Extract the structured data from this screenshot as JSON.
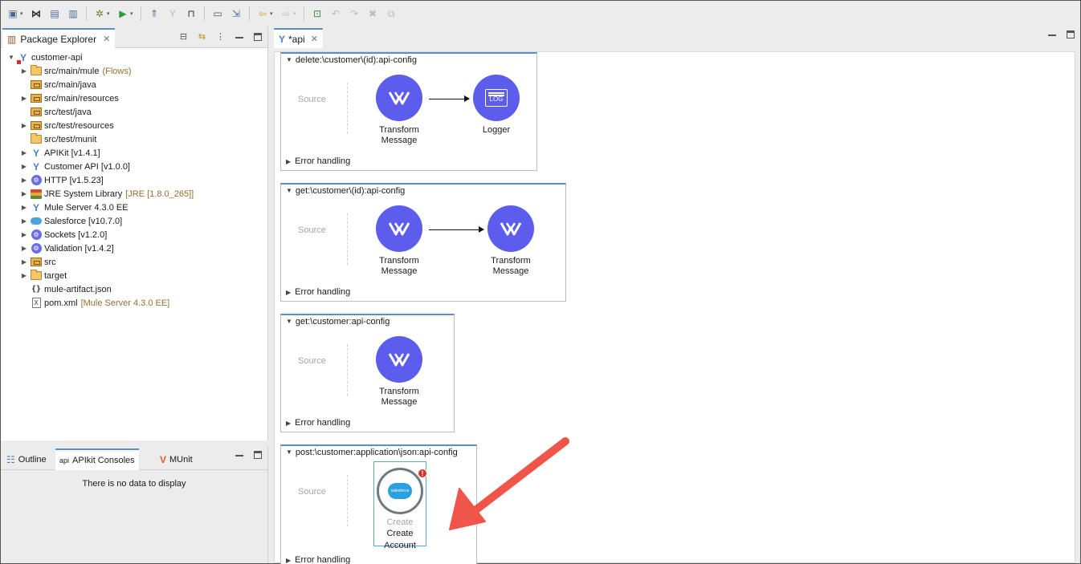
{
  "toolbar": {
    "buttons": [
      "new-wizard-icon",
      "mule-studio-icon",
      "save-icon",
      "save-all-icon",
      "debug-icon",
      "run-icon",
      "deploy-icon",
      "plug-icon",
      "lock-icon",
      "mediator-icon",
      "import-icon",
      "back-icon",
      "forward-icon",
      "new-task-icon",
      "undo-icon",
      "redo-icon",
      "delete-icon",
      "copy-icon"
    ]
  },
  "package_explorer": {
    "tab_label": "Package Explorer",
    "tree": [
      {
        "label": "customer-api",
        "deco": "",
        "icon": "mule-project-icon",
        "expanded": true,
        "level": 0
      },
      {
        "label": "src/main/mule",
        "deco": "(Flows)",
        "icon": "folder-icon",
        "expandable": true,
        "level": 1
      },
      {
        "label": "src/main/java",
        "deco": "",
        "icon": "package-icon",
        "expandable": false,
        "level": 1
      },
      {
        "label": "src/main/resources",
        "deco": "",
        "icon": "package-icon",
        "expandable": true,
        "level": 1
      },
      {
        "label": "src/test/java",
        "deco": "",
        "icon": "package-icon",
        "expandable": false,
        "level": 1
      },
      {
        "label": "src/test/resources",
        "deco": "",
        "icon": "package-icon",
        "expandable": true,
        "level": 1
      },
      {
        "label": "src/test/munit",
        "deco": "",
        "icon": "folder-icon",
        "expandable": false,
        "level": 1
      },
      {
        "label": "APIKit [v1.4.1]",
        "deco": "",
        "icon": "mule-lib-icon",
        "expandable": true,
        "level": 1
      },
      {
        "label": "Customer API [v1.0.0]",
        "deco": "",
        "icon": "mule-lib-icon",
        "expandable": true,
        "level": 1
      },
      {
        "label": "HTTP [v1.5.23]",
        "deco": "",
        "icon": "connector-icon",
        "expandable": true,
        "level": 1
      },
      {
        "label": "JRE System Library",
        "deco": "[JRE [1.8.0_265]]",
        "icon": "jre-icon",
        "expandable": true,
        "level": 1
      },
      {
        "label": "Mule Server 4.3.0 EE",
        "deco": "",
        "icon": "mule-lib-icon",
        "expandable": true,
        "level": 1
      },
      {
        "label": "Salesforce [v10.7.0]",
        "deco": "",
        "icon": "salesforce-icon",
        "expandable": true,
        "level": 1
      },
      {
        "label": "Sockets [v1.2.0]",
        "deco": "",
        "icon": "connector-icon",
        "expandable": true,
        "level": 1
      },
      {
        "label": "Validation [v1.4.2]",
        "deco": "",
        "icon": "connector-icon",
        "expandable": true,
        "level": 1
      },
      {
        "label": "src",
        "deco": "",
        "icon": "package-icon",
        "expandable": true,
        "level": 1
      },
      {
        "label": "target",
        "deco": "",
        "icon": "folder-icon",
        "expandable": true,
        "level": 1
      },
      {
        "label": "mule-artifact.json",
        "deco": "",
        "icon": "json-file-icon",
        "expandable": false,
        "level": 1
      },
      {
        "label": "pom.xml",
        "deco": "[Mule Server 4.3.0 EE]",
        "icon": "xml-file-icon",
        "expandable": false,
        "level": 1
      }
    ]
  },
  "console": {
    "tabs": [
      {
        "label": "Outline",
        "icon_text": ""
      },
      {
        "label": "APIkit Consoles",
        "icon_text": "api"
      },
      {
        "label": "MUnit",
        "icon_text": ""
      }
    ],
    "empty_text": "There is no data to display"
  },
  "editor": {
    "tab_label": "*api",
    "flows": [
      {
        "title": "delete:\\customer\\(id):api-config",
        "source": "Source",
        "error_handling": "Error handling",
        "nodes": [
          {
            "label1": "Transform",
            "label2": "Message",
            "kind": "transform"
          },
          {
            "label1": "Logger",
            "label2": "",
            "kind": "logger",
            "icon_text": "LOG"
          }
        ]
      },
      {
        "title": "get:\\customer\\(id):api-config",
        "source": "Source",
        "error_handling": "Error handling",
        "nodes": [
          {
            "label1": "Transform",
            "label2": "Message",
            "kind": "transform"
          },
          {
            "label1": "Transform",
            "label2": "Message",
            "kind": "transform"
          }
        ]
      },
      {
        "title": "get:\\customer:api-config",
        "source": "Source",
        "error_handling": "Error handling",
        "nodes": [
          {
            "label1": "Transform",
            "label2": "Message",
            "kind": "transform"
          }
        ]
      },
      {
        "title": "post:\\customer:application\\json:api-config",
        "source": "Source",
        "error_handling": "Error handling",
        "nodes": [
          {
            "label1": "Create",
            "label2": "Create Account",
            "kind": "salesforce",
            "logo_text": "salesforce",
            "error_mark": "!"
          }
        ]
      }
    ]
  },
  "annotation": {
    "color": "#f0554a"
  }
}
